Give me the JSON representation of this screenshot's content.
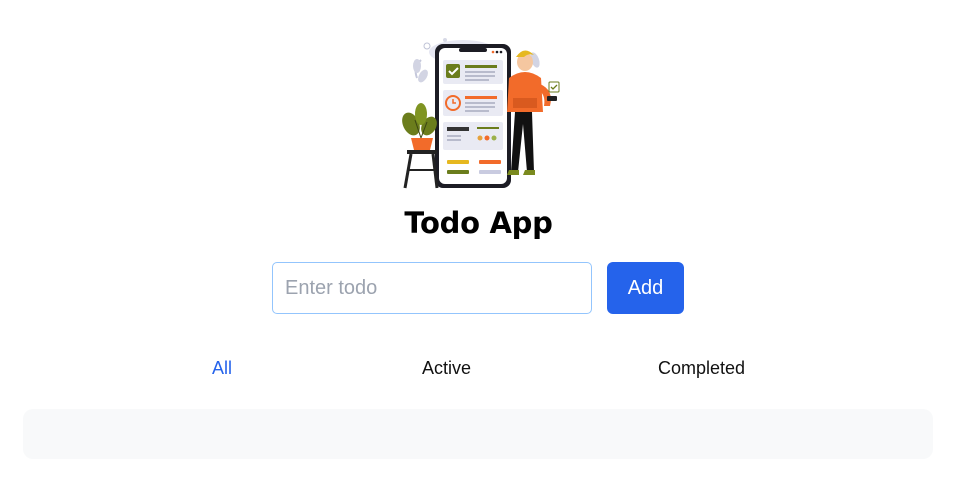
{
  "app": {
    "title": "Todo App"
  },
  "form": {
    "input_value": "",
    "input_placeholder": "Enter todo",
    "add_label": "Add"
  },
  "filters": {
    "items": [
      {
        "label": "All",
        "active": true
      },
      {
        "label": "Active",
        "active": false
      },
      {
        "label": "Completed",
        "active": false
      }
    ]
  },
  "todos": [],
  "colors": {
    "accent": "#2563eb",
    "input_border": "#93c5fd",
    "list_background": "#f8f9fa",
    "illustration_orange": "#f26b2a",
    "illustration_olive": "#7a8a1e"
  },
  "icons": {
    "hero": "todo-phone-illustration"
  }
}
